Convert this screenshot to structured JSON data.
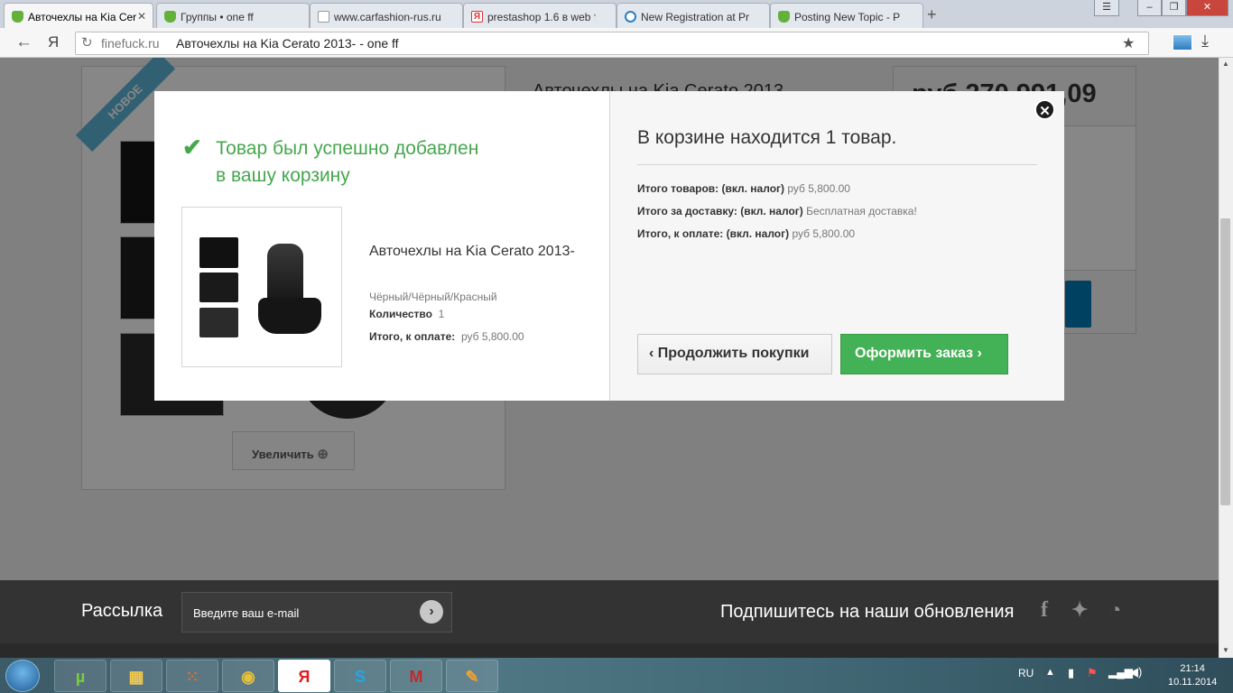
{
  "browser": {
    "tabs": [
      {
        "title": "Авточехлы на Kia Cera",
        "active": true
      },
      {
        "title": "Группы • one ff"
      },
      {
        "title": "www.carfashion-rus.ru"
      },
      {
        "title": "prestashop 1.6 в web т"
      },
      {
        "title": "New Registration at Pr"
      },
      {
        "title": "Posting New Topic - P"
      }
    ],
    "newtab": "+",
    "ya": "Я",
    "domain": "finefuck.ru",
    "page_title": "Авточехлы на Kia Cerato 2013- - one ff"
  },
  "background_page": {
    "badge": "НОВОЕ",
    "product_title": "Авточехлы на Kia Cerato 2013",
    "price": "руб 270 991,09",
    "zoom_label": "Увеличить"
  },
  "modal": {
    "success_message": "Товар был успешно добавлен в вашу корзину",
    "product_name": "Авточехлы на Kia Cerato 2013-",
    "product_attributes": "Чёрный/Чёрный/Красный",
    "quantity_label": "Количество",
    "quantity_value": "1",
    "total_label": "Итого, к оплате:",
    "total_value": "руб 5,800.00",
    "cart_heading": "В корзине находится 1 товар.",
    "cart_rows": [
      {
        "label": "Итого товаров: (вкл. налог)",
        "value": "руб 5,800.00"
      },
      {
        "label": "Итого за доставку: (вкл. налог)",
        "value": "Бесплатная доставка!"
      },
      {
        "label": "Итого, к оплате: (вкл. налог)",
        "value": "руб 5,800.00"
      }
    ],
    "continue_label": "Продолжить покупки",
    "checkout_label": "Оформить заказ"
  },
  "footer": {
    "newsletter_label": "Рассылка",
    "email_placeholder": "Введите ваш e-mail",
    "subscribe_label": "Подпишитесь на наши обновления",
    "social": [
      "facebook-icon",
      "twitter-icon",
      "rss-icon"
    ]
  },
  "taskbar": {
    "apps": [
      "utorrent-icon",
      "explorer-icon",
      "apps-grid-icon",
      "chrome-icon",
      "yandex-icon",
      "skype-icon",
      "mcafee-icon",
      "paint-icon"
    ],
    "language": "RU",
    "time": "21:14",
    "date": "10.11.2014"
  },
  "colors": {
    "success_green": "#46a74e",
    "checkout_green": "#43b155",
    "footer_dark": "#333333"
  }
}
